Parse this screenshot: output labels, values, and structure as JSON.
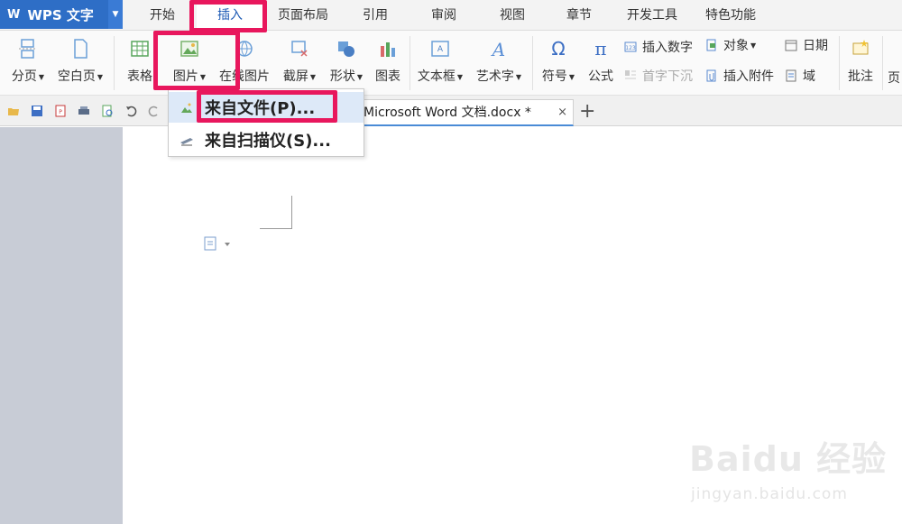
{
  "app": {
    "logo": "W",
    "title": "WPS 文字"
  },
  "menu_tabs": [
    "开始",
    "插入",
    "页面布局",
    "引用",
    "审阅",
    "视图",
    "章节",
    "开发工具",
    "特色功能"
  ],
  "ribbon": {
    "page_break": "分页",
    "blank_page": "空白页",
    "table": "表格",
    "picture": "图片",
    "online_picture": "在线图片",
    "screenshot": "截屏",
    "shape": "形状",
    "chart": "图表",
    "textbox": "文本框",
    "wordart": "艺术字",
    "symbol": "符号",
    "equation": "公式",
    "insert_number": "插入数字",
    "drop_cap": "首字下沉",
    "object": "对象",
    "attachment": "插入附件",
    "date": "日期",
    "field": "域",
    "comment": "批注",
    "page_partial": "页"
  },
  "document_tab": {
    "title": "Microsoft Word 文档.docx *",
    "close": "×",
    "new": "+"
  },
  "picture_dropdown": {
    "items": [
      "来自文件(P)...",
      "来自扫描仪(S)..."
    ]
  },
  "watermark": {
    "text": "Baidu 经验",
    "url": "jingyan.baidu.com"
  },
  "colors": {
    "app_blue": "#2e6ec6",
    "highlight": "#e8175d",
    "active_tab_text": "#1f5bb5",
    "hover_bg": "#dde9f8"
  }
}
